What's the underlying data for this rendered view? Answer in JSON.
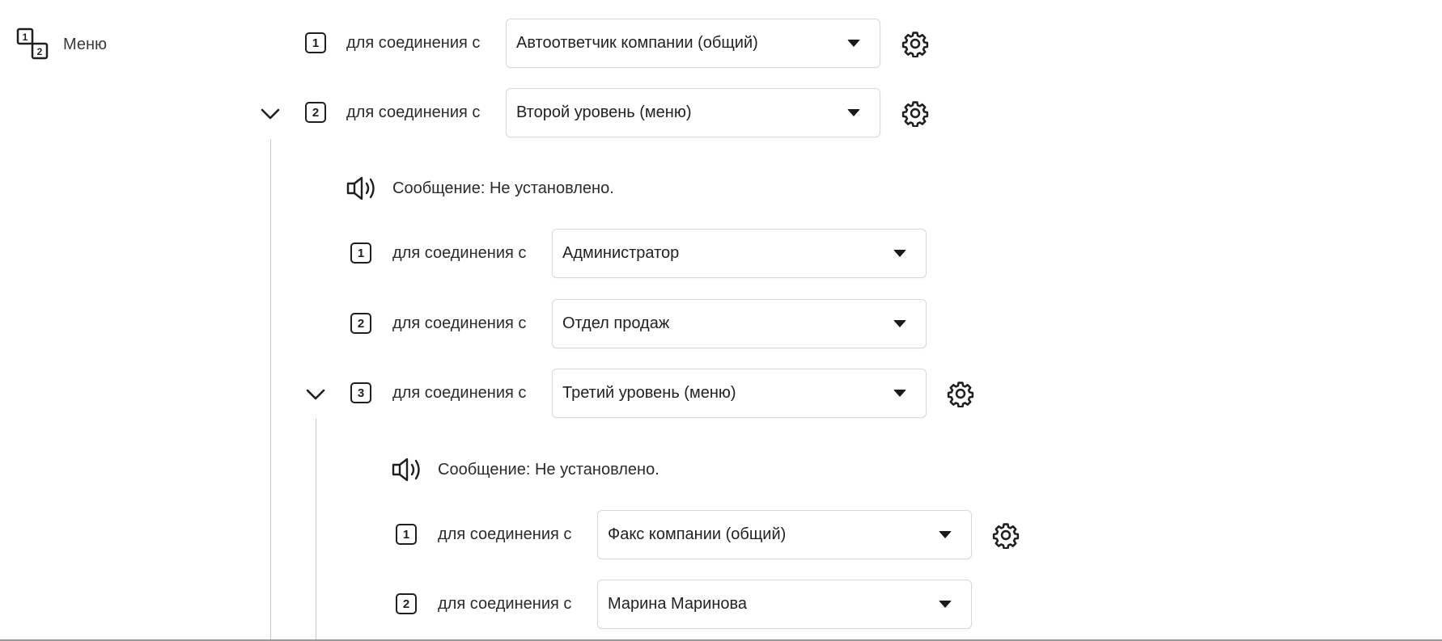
{
  "menu": {
    "title": "Меню",
    "icon": "menu-numbers-icon"
  },
  "connect_label": "для соединения с",
  "level1": [
    {
      "num": "1",
      "value": "Автоответчик компании (общий)"
    },
    {
      "num": "2",
      "value": "Второй уровень (меню)"
    }
  ],
  "level2": {
    "message": "Сообщение: Не установлено.",
    "items": [
      {
        "num": "1",
        "value": "Администратор"
      },
      {
        "num": "2",
        "value": "Отдел продаж"
      },
      {
        "num": "3",
        "value": "Третий уровень (меню)"
      }
    ]
  },
  "level3": {
    "message": "Сообщение: Не установлено.",
    "items": [
      {
        "num": "1",
        "value": "Факс компании (общий)"
      },
      {
        "num": "2",
        "value": "Марина Маринова"
      }
    ]
  },
  "icons": {
    "settings": "gear-icon",
    "expand": "chevron-down-icon",
    "speaker": "speaker-icon",
    "dropdown": "caret-down-icon"
  }
}
